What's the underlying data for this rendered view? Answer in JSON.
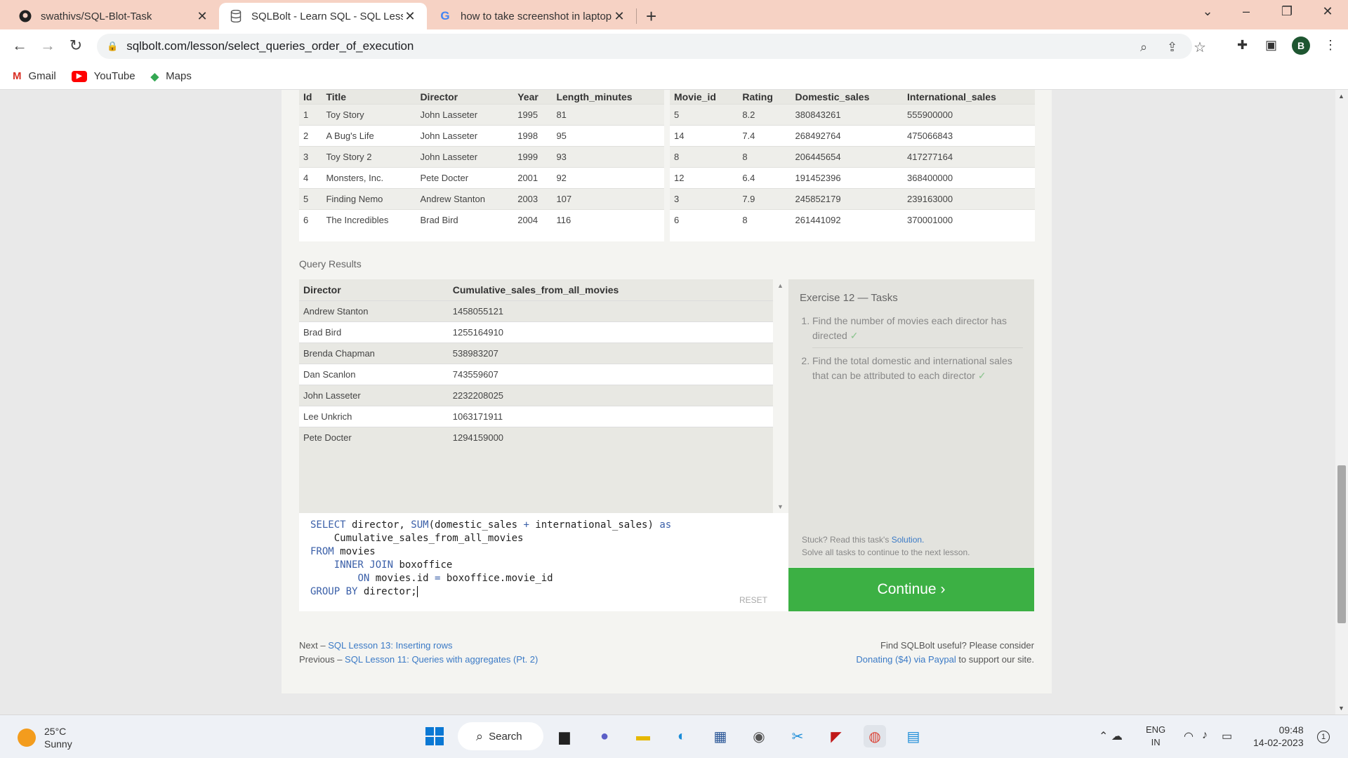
{
  "browser": {
    "tabs": [
      {
        "label": "swathivs/SQL-Blot-Task",
        "icon": "github-icon"
      },
      {
        "label": "SQLBolt - Learn SQL - SQL Lesso",
        "icon": "database-icon"
      },
      {
        "label": "how to take screenshot in laptop",
        "icon": "google-icon"
      }
    ],
    "url": "sqlbolt.com/lesson/select_queries_order_of_execution",
    "profile_initial": "B",
    "bookmarks": [
      {
        "label": "Gmail",
        "icon": "gmail-icon"
      },
      {
        "label": "YouTube",
        "icon": "youtube-icon"
      },
      {
        "label": "Maps",
        "icon": "maps-icon"
      }
    ]
  },
  "movies_table": {
    "headers": [
      "Id",
      "Title",
      "Director",
      "Year",
      "Length_minutes"
    ],
    "rows": [
      [
        "1",
        "Toy Story",
        "John Lasseter",
        "1995",
        "81"
      ],
      [
        "2",
        "A Bug's Life",
        "John Lasseter",
        "1998",
        "95"
      ],
      [
        "3",
        "Toy Story 2",
        "John Lasseter",
        "1999",
        "93"
      ],
      [
        "4",
        "Monsters, Inc.",
        "Pete Docter",
        "2001",
        "92"
      ],
      [
        "5",
        "Finding Nemo",
        "Andrew Stanton",
        "2003",
        "107"
      ],
      [
        "6",
        "The Incredibles",
        "Brad Bird",
        "2004",
        "116"
      ]
    ]
  },
  "boxoffice_table": {
    "headers": [
      "Movie_id",
      "Rating",
      "Domestic_sales",
      "International_sales"
    ],
    "rows": [
      [
        "5",
        "8.2",
        "380843261",
        "555900000"
      ],
      [
        "14",
        "7.4",
        "268492764",
        "475066843"
      ],
      [
        "8",
        "8",
        "206445654",
        "417277164"
      ],
      [
        "12",
        "6.4",
        "191452396",
        "368400000"
      ],
      [
        "3",
        "7.9",
        "245852179",
        "239163000"
      ],
      [
        "6",
        "8",
        "261441092",
        "370001000"
      ]
    ]
  },
  "query_results": {
    "label": "Query Results",
    "headers": [
      "Director",
      "Cumulative_sales_from_all_movies"
    ],
    "rows": [
      [
        "Andrew Stanton",
        "1458055121"
      ],
      [
        "Brad Bird",
        "1255164910"
      ],
      [
        "Brenda Chapman",
        "538983207"
      ],
      [
        "Dan Scanlon",
        "743559607"
      ],
      [
        "John Lasseter",
        "2232208025"
      ],
      [
        "Lee Unkrich",
        "1063171911"
      ],
      [
        "Pete Docter",
        "1294159000"
      ]
    ]
  },
  "tasks": {
    "title": "Exercise 12 — Tasks",
    "items": [
      "Find the number of movies each director has directed",
      "Find the total domestic and international sales that can be attributed to each director"
    ],
    "check": "✓",
    "stuck_prefix": "Stuck? Read this task's ",
    "solution_link": "Solution.",
    "solve_all": "Solve all tasks to continue to the next lesson."
  },
  "editor": {
    "reset_label": "RESET"
  },
  "continue_label": "Continue ›",
  "footer": {
    "next_prefix": "Next – ",
    "next_link": "SQL Lesson 13: Inserting rows",
    "prev_prefix": "Previous – ",
    "prev_link": "SQL Lesson 11: Queries with aggregates (Pt. 2)",
    "support_line1": "Find SQLBolt useful? Please consider",
    "support_link": "Donating ($4) via Paypal",
    "support_suffix": " to support our site."
  },
  "taskbar": {
    "temp": "25°C",
    "weather": "Sunny",
    "search_label": "Search",
    "lang1": "ENG",
    "lang2": "IN",
    "time": "09:48",
    "date": "14-02-2023",
    "notifications": "1"
  }
}
